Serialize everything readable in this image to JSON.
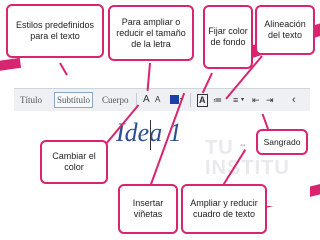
{
  "callouts": {
    "estilos": "Estilos predefinidos para el texto",
    "ampliar": "Para ampliar o reducir el tamaño de la letra",
    "fijar_color": "Fijar color de fondo",
    "alineacion": "Alineación del texto",
    "sangrado": "Sangrado",
    "cambiar_color": "Cambiar el color",
    "insertar_vinetas": "Insertar viñetas",
    "ampliar_reducir_cuadro": "Ampliar y reducir cuadro de texto"
  },
  "toolbar": {
    "style_titulo": "Título",
    "style_subtitulo": "Subtítulo",
    "style_cuerpo": "Cuerpo",
    "font_size_increase": "A",
    "font_size_decrease": "A",
    "font_color_icon": "text-color-icon",
    "background_color_icon": "highlight-icon",
    "background_glyph": "A",
    "bullets_glyph": "≔",
    "align_glyph": "≡",
    "indent_decrease_glyph": "⇤",
    "indent_increase_glyph": "⇥",
    "collapse_glyph": "‹"
  },
  "document": {
    "title_text": "Idea 1"
  },
  "watermark": {
    "line1": "TU",
    "line2": "INSTITU"
  },
  "colors": {
    "accent": "#d9246f",
    "text_color_swatch": "#1b3ea8"
  }
}
